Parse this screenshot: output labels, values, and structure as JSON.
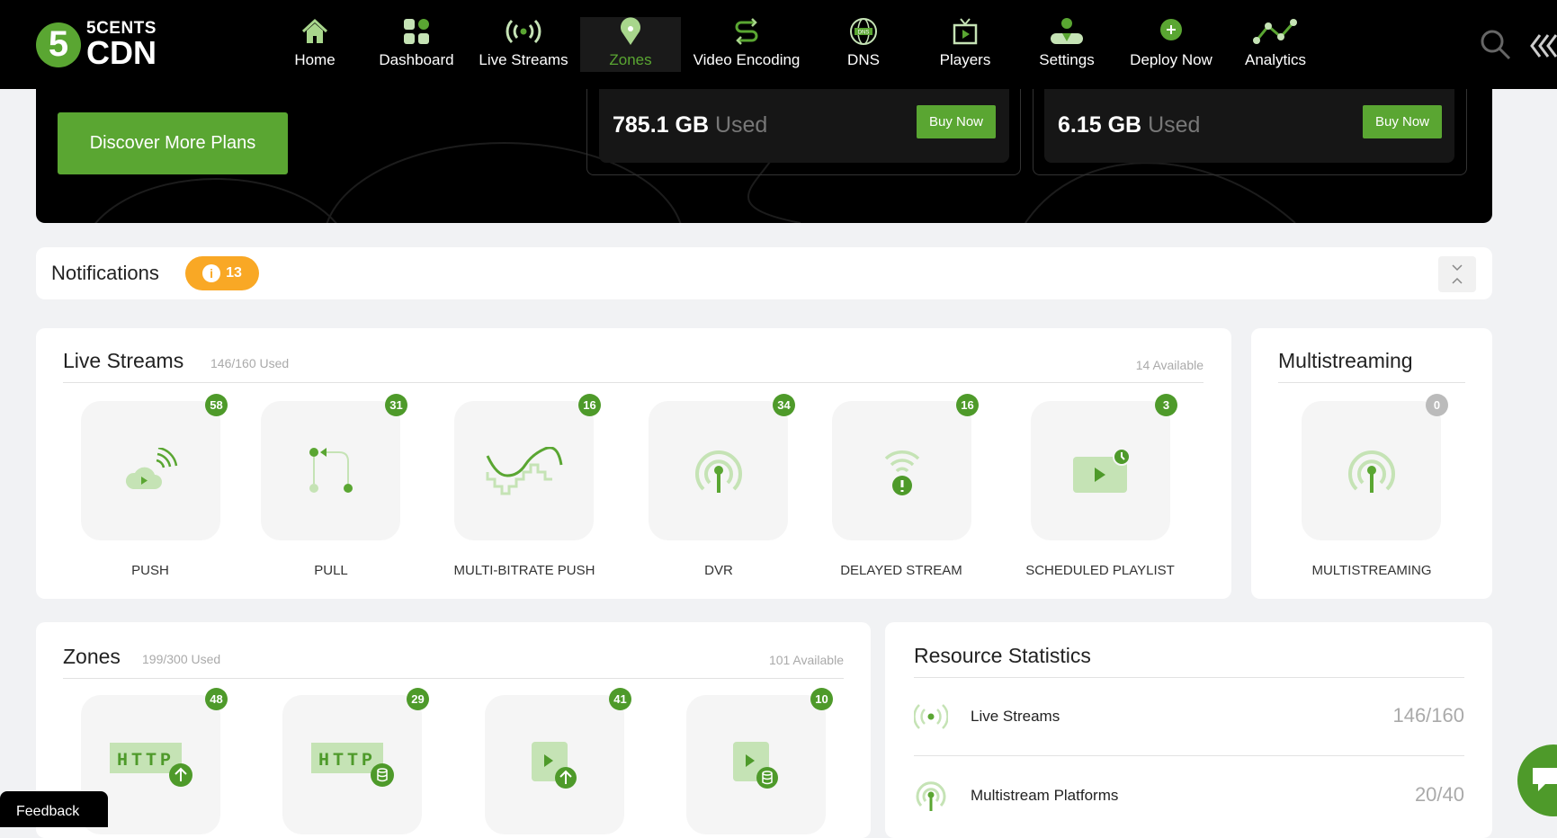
{
  "brand": {
    "logo_number": "5",
    "logo_line1": "5CENTS",
    "logo_line2": "CDN"
  },
  "nav": {
    "items": [
      {
        "label": "Home",
        "icon": "home-icon"
      },
      {
        "label": "Dashboard",
        "icon": "dashboard-icon"
      },
      {
        "label": "Live Streams",
        "icon": "broadcast-icon"
      },
      {
        "label": "Zones",
        "icon": "location-pin-icon",
        "active": true
      },
      {
        "label": "Video Encoding",
        "icon": "encoding-icon"
      },
      {
        "label": "DNS",
        "icon": "globe-dns-icon"
      },
      {
        "label": "Players",
        "icon": "tv-play-icon"
      },
      {
        "label": "Settings",
        "icon": "user-settings-icon"
      },
      {
        "label": "Deploy Now",
        "icon": "plus-circle-icon"
      },
      {
        "label": "Analytics",
        "icon": "analytics-icon"
      }
    ],
    "dns_icon_text": "DNS"
  },
  "hero": {
    "discover_label": "Discover More Plans",
    "usage": [
      {
        "amount": "785.1 GB",
        "suffix": "Used",
        "button": "Buy Now"
      },
      {
        "amount": "6.15 GB",
        "suffix": "Used",
        "button": "Buy Now"
      }
    ]
  },
  "notifications": {
    "title": "Notifications",
    "count": "13"
  },
  "live_streams": {
    "title": "Live Streams",
    "used": "146/160 Used",
    "available": "14 Available",
    "tiles": [
      {
        "label": "PUSH",
        "count": "58"
      },
      {
        "label": "PULL",
        "count": "31"
      },
      {
        "label": "MULTI-BITRATE PUSH",
        "count": "16"
      },
      {
        "label": "DVR",
        "count": "34"
      },
      {
        "label": "DELAYED STREAM",
        "count": "16"
      },
      {
        "label": "SCHEDULED PLAYLIST",
        "count": "3"
      }
    ]
  },
  "multistreaming": {
    "title": "Multistreaming",
    "tile": {
      "label": "MULTISTREAMING",
      "count": "0"
    }
  },
  "zones": {
    "title": "Zones",
    "used": "199/300 Used",
    "available": "101 Available",
    "tiles": [
      {
        "count": "48",
        "icon_text": "HTTP"
      },
      {
        "count": "29",
        "icon_text": "HTTP"
      },
      {
        "count": "41"
      },
      {
        "count": "10"
      }
    ]
  },
  "resource_stats": {
    "title": "Resource Statistics",
    "rows": [
      {
        "label": "Live Streams",
        "value": "146/160"
      },
      {
        "label": "Multistream Platforms",
        "value": "20/40"
      }
    ]
  },
  "feedback_label": "Feedback",
  "colors": {
    "accent": "#5aa632",
    "badge": "#4e9a2a",
    "notification": "#f9a825"
  }
}
